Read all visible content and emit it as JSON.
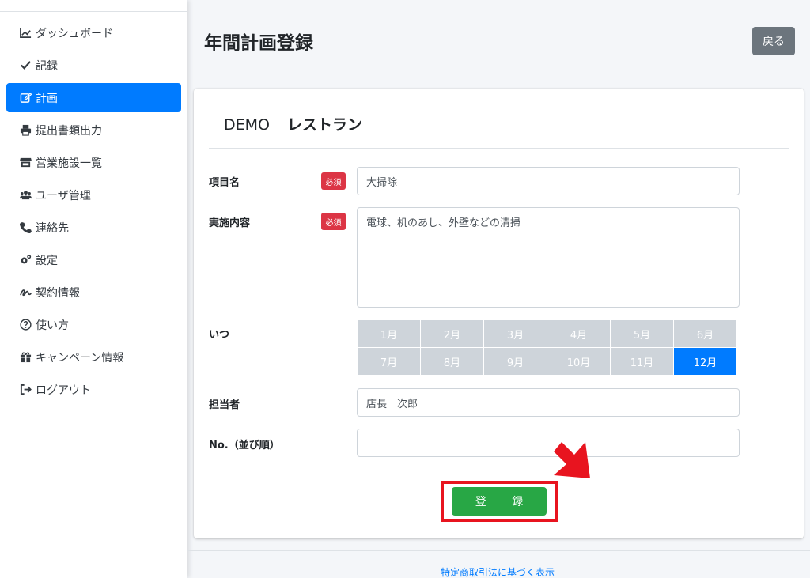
{
  "sidebar": {
    "items": [
      {
        "label": "ダッシュボード",
        "icon": "chart-line-icon",
        "active": false
      },
      {
        "label": "記録",
        "icon": "check-icon",
        "active": false
      },
      {
        "label": "計画",
        "icon": "edit-icon",
        "active": true
      },
      {
        "label": "提出書類出力",
        "icon": "printer-icon",
        "active": false
      },
      {
        "label": "営業施設一覧",
        "icon": "store-icon",
        "active": false
      },
      {
        "label": "ユーザ管理",
        "icon": "users-icon",
        "active": false
      },
      {
        "label": "連絡先",
        "icon": "phone-icon",
        "active": false
      },
      {
        "label": "設定",
        "icon": "cogs-icon",
        "active": false
      },
      {
        "label": "契約情報",
        "icon": "signature-icon",
        "active": false
      },
      {
        "label": "使い方",
        "icon": "question-circle-icon",
        "active": false
      },
      {
        "label": "キャンペーン情報",
        "icon": "gift-icon",
        "active": false
      },
      {
        "label": "ログアウト",
        "icon": "sign-out-icon",
        "active": false
      }
    ]
  },
  "header": {
    "title": "年間計画登録",
    "back_label": "戻る"
  },
  "form": {
    "organization": "DEMO",
    "store_name": "レストラン",
    "required_badge": "必須",
    "item_name": {
      "label": "項目名",
      "value": "大掃除"
    },
    "content": {
      "label": "実施内容",
      "value": "電球、机のあし、外壁などの清掃"
    },
    "when": {
      "label": "いつ",
      "months": [
        "1月",
        "2月",
        "3月",
        "4月",
        "5月",
        "6月",
        "7月",
        "8月",
        "9月",
        "10月",
        "11月",
        "12月"
      ],
      "selected": "12月"
    },
    "person": {
      "label": "担当者",
      "value": "店長　次郎"
    },
    "order": {
      "label": "No.（並び順）",
      "value": ""
    },
    "submit_label": "登 録"
  },
  "footer": {
    "link": "特定商取引法に基づく表示"
  },
  "colors": {
    "primary": "#007bff",
    "success": "#28a745",
    "danger": "#dc3545",
    "secondary": "#6c757d",
    "highlight": "#e8141f"
  }
}
